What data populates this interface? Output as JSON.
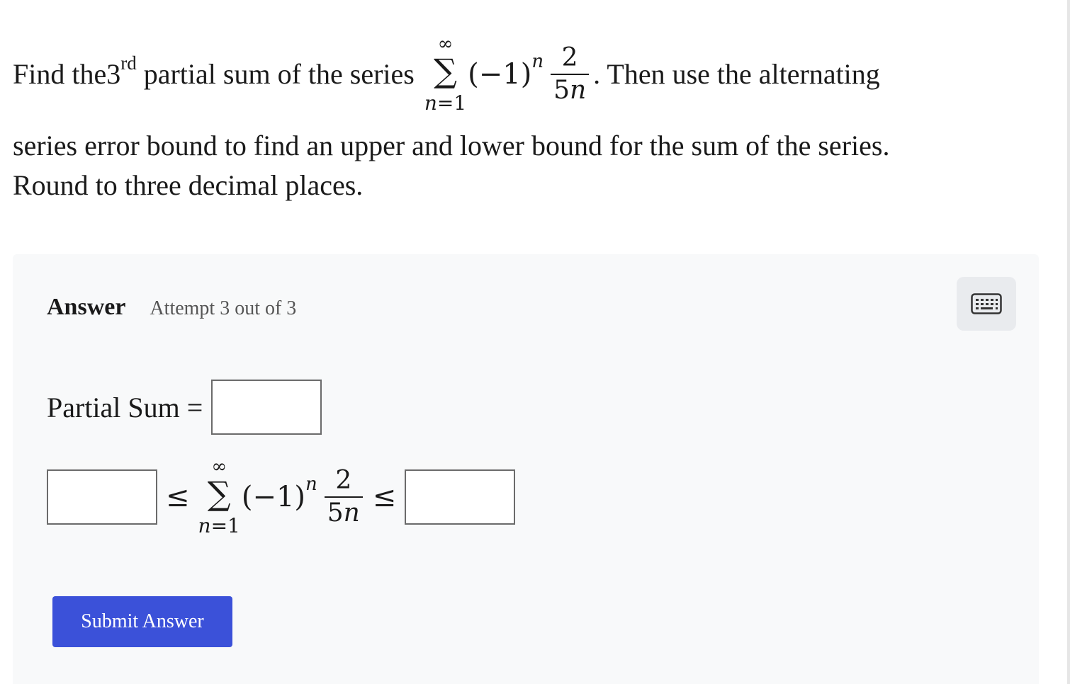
{
  "question": {
    "line1_prefix": "Find the ",
    "ordinal_number": "3",
    "ordinal_suffix": "rd",
    "line1_mid": " partial sum of the series ",
    "line1_suffix": ". Then use the alternating",
    "line2": "series error bound to find an upper and lower bound for the sum of the series.",
    "line3": "Round to three decimal places.",
    "series": {
      "upper_limit": "∞",
      "sigma": "∑",
      "lower_var": "n",
      "lower_eq": "=1",
      "base": "(−1)",
      "exponent": "n",
      "numerator": "2",
      "denominator_coef": "5",
      "denominator_var": "n"
    }
  },
  "answer": {
    "title": "Answer",
    "attempt": "Attempt 3 out of 3",
    "partial_sum_label": "Partial Sum =",
    "partial_sum_value": "",
    "lower_bound_value": "",
    "upper_bound_value": "",
    "leq_symbol": "≤",
    "submit_label": "Submit Answer"
  },
  "icons": {
    "keyboard": "keyboard-icon"
  },
  "colors": {
    "submit_bg": "#3b51d9",
    "panel_bg": "#f8f9fa",
    "keyboard_btn_bg": "#e9ebee"
  }
}
